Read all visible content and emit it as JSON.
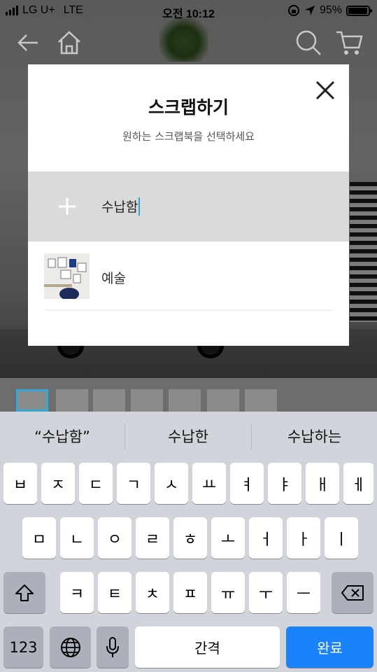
{
  "status_bar": {
    "carrier": "LG U+",
    "network": "LTE",
    "time": "오전 10:12",
    "battery": "95%",
    "battery_level": 0.95
  },
  "modal": {
    "title": "스크랩하기",
    "subtitle": "원하는 스크랩북을 선택하세요",
    "new_scrapbook_input": "수납함",
    "items": [
      {
        "label": "예술"
      }
    ]
  },
  "keyboard": {
    "predictions": [
      "“수납함”",
      "수납한",
      "수납하는"
    ],
    "row1": [
      "ㅂ",
      "ㅈ",
      "ㄷ",
      "ㄱ",
      "ㅅ",
      "ㅛ",
      "ㅕ",
      "ㅑ",
      "ㅐ",
      "ㅔ"
    ],
    "row2": [
      "ㅁ",
      "ㄴ",
      "ㅇ",
      "ㄹ",
      "ㅎ",
      "ㅗ",
      "ㅓ",
      "ㅏ",
      "ㅣ"
    ],
    "row3": [
      "ㅋ",
      "ㅌ",
      "ㅊ",
      "ㅍ",
      "ㅠ",
      "ㅜ",
      "ㅡ"
    ],
    "numbers_key": "123",
    "space_key": "간격",
    "done_key": "완료"
  },
  "colors": {
    "accent": "#1a82fb",
    "caret": "#2aa6d6"
  },
  "icons": [
    "back-arrow-icon",
    "home-icon",
    "search-icon",
    "cart-icon",
    "close-icon",
    "plus-icon",
    "shift-icon",
    "backspace-icon",
    "globe-icon",
    "microphone-icon"
  ]
}
